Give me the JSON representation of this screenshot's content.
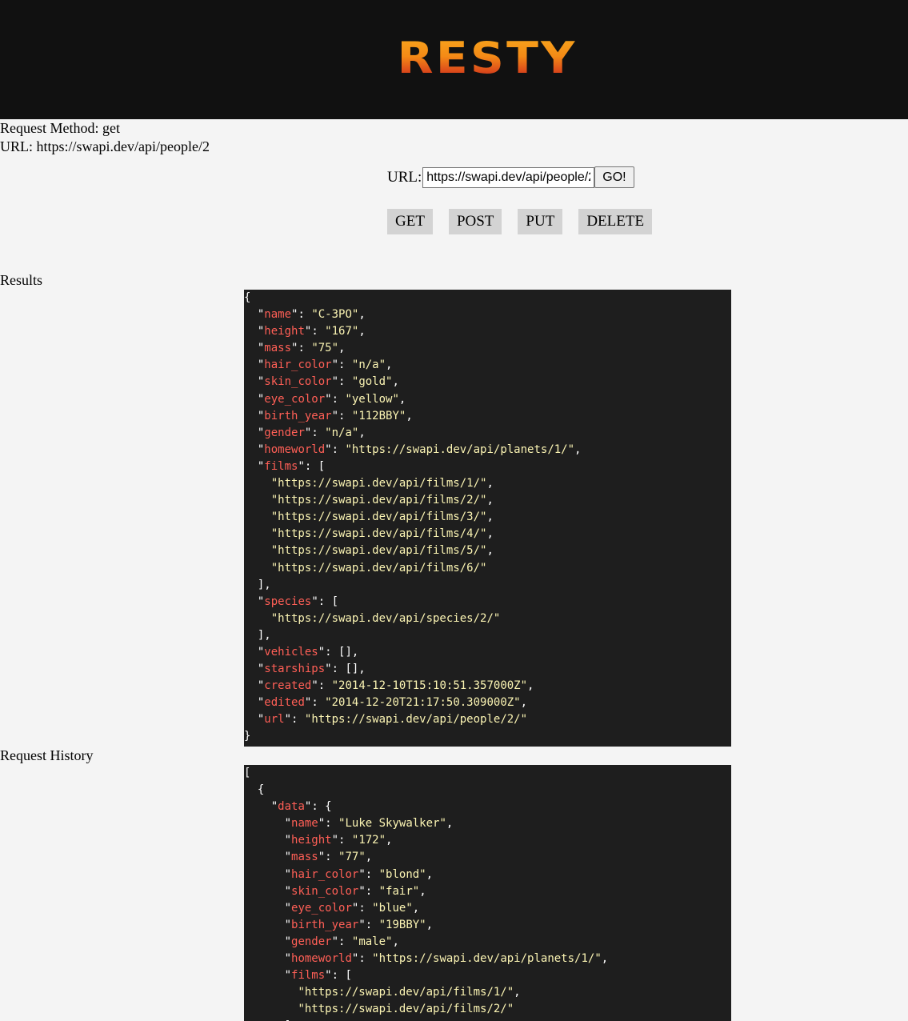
{
  "header": {
    "logo_text": "RESTY"
  },
  "request_info": {
    "method_line": "Request Method: get",
    "url_line": "URL: https://swapi.dev/api/people/2"
  },
  "form": {
    "url_label": "URL:",
    "url_value": "https://swapi.dev/api/people/2",
    "go_label": "GO!",
    "methods": [
      "GET",
      "POST",
      "PUT",
      "DELETE"
    ]
  },
  "results": {
    "label": "Results",
    "json": {
      "name": "C-3PO",
      "height": "167",
      "mass": "75",
      "hair_color": "n/a",
      "skin_color": "gold",
      "eye_color": "yellow",
      "birth_year": "112BBY",
      "gender": "n/a",
      "homeworld": "https://swapi.dev/api/planets/1/",
      "films": [
        "https://swapi.dev/api/films/1/",
        "https://swapi.dev/api/films/2/",
        "https://swapi.dev/api/films/3/",
        "https://swapi.dev/api/films/4/",
        "https://swapi.dev/api/films/5/",
        "https://swapi.dev/api/films/6/"
      ],
      "species": [
        "https://swapi.dev/api/species/2/"
      ],
      "vehicles": [],
      "starships": [],
      "created": "2014-12-10T15:10:51.357000Z",
      "edited": "2014-12-20T21:17:50.309000Z",
      "url": "https://swapi.dev/api/people/2/"
    }
  },
  "history": {
    "label": "Request History",
    "json": [
      {
        "data": {
          "name": "Luke Skywalker",
          "height": "172",
          "mass": "77",
          "hair_color": "blond",
          "skin_color": "fair",
          "eye_color": "blue",
          "birth_year": "19BBY",
          "gender": "male",
          "homeworld": "https://swapi.dev/api/planets/1/",
          "films": [
            "https://swapi.dev/api/films/1/",
            "https://swapi.dev/api/films/2/"
          ]
        }
      }
    ]
  }
}
